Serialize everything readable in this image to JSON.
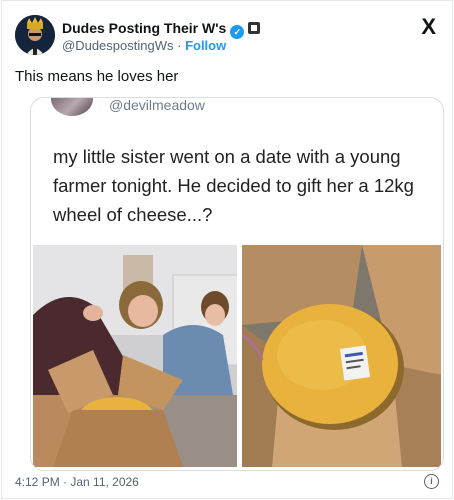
{
  "author": {
    "display_name": "Dudes Posting Their W's",
    "verified_icon": "verified-badge-icon",
    "handle": "@DudespostingWs",
    "separator": "·",
    "follow_label": "Follow"
  },
  "platform_logo": "X",
  "tweet": {
    "text": "This means he loves her",
    "timestamp": "4:12 PM · Jan 11, 2026"
  },
  "quoted": {
    "handle": "@devilmeadow",
    "text": "my little sister went on a date with a young farmer tonight. He decided to gift her a 12kg wheel of cheese...?"
  },
  "colors": {
    "accent": "#1d9bf0",
    "cheese": "#e8b23c",
    "cardboard": "#b88a5e"
  }
}
